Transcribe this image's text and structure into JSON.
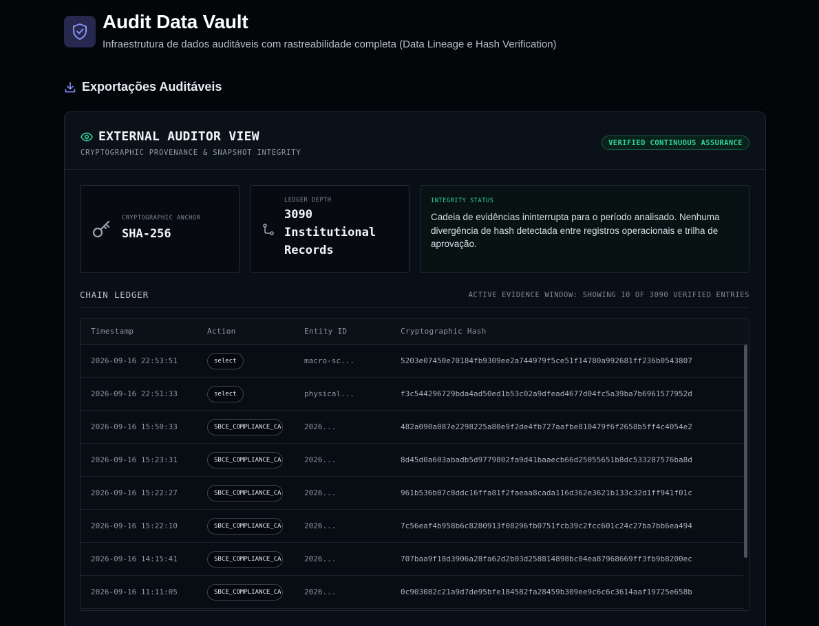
{
  "app": {
    "title": "Audit Data Vault",
    "subtitle": "Infraestrutura de dados auditáveis com rastreabilidade completa (Data Lineage e Hash Verification)"
  },
  "section": {
    "title": "Exportações Auditáveis"
  },
  "auditor_view": {
    "title": "EXTERNAL AUDITOR VIEW",
    "subtitle": "CRYPTOGRAPHIC PROVENANCE & SNAPSHOT INTEGRITY",
    "badge": "VERIFIED CONTINUOUS ASSURANCE"
  },
  "stats": {
    "anchor": {
      "label": "CRYPTOGRAPHIC ANCHOR",
      "value": "SHA-256"
    },
    "depth": {
      "label": "LEDGER DEPTH",
      "value": "3090 Institutional Records"
    },
    "integrity": {
      "label": "INTEGRITY STATUS",
      "text": "Cadeia de evidências ininterrupta para o período analisado. Nenhuma divergência de hash detectada entre registros operacionais e trilha de aprovação."
    }
  },
  "ledger": {
    "title": "CHAIN LEDGER",
    "meta": "ACTIVE EVIDENCE WINDOW: SHOWING 10 OF 3090 VERIFIED ENTRIES",
    "columns": [
      "Timestamp",
      "Action",
      "Entity ID",
      "Cryptographic Hash"
    ],
    "rows": [
      {
        "timestamp": "2026-09-16 22:53:51",
        "action": "select",
        "entity": "macro-sc...",
        "hash": "5203e07450e70184fb9309ee2a744979f5ce51f14780a992681ff236b0543807"
      },
      {
        "timestamp": "2026-09-16 22:51:33",
        "action": "select",
        "entity": "physical...",
        "hash": "f3c544296729bda4ad50ed1b53c02a9dfead4677d04fc5a39ba7b6961577952d"
      },
      {
        "timestamp": "2026-09-16 15:50:33",
        "action": "SBCE_COMPLIANCE_CA",
        "entity": "2026...",
        "hash": "482a090a087e2298225a80e9f2de4fb727aafbe810479f6f2658b5ff4c4054e2"
      },
      {
        "timestamp": "2026-09-16 15:23:31",
        "action": "SBCE_COMPLIANCE_CA",
        "entity": "2026...",
        "hash": "8d45d0a603abadb5d9779802fa9d41baaecb66d25055651b8dc533287576ba8d"
      },
      {
        "timestamp": "2026-09-16 15:22:27",
        "action": "SBCE_COMPLIANCE_CA",
        "entity": "2026...",
        "hash": "961b536b07c8ddc16ffa81f2faeaa8cada116d362e3621b133c32d1ff941f01c"
      },
      {
        "timestamp": "2026-09-16 15:22:10",
        "action": "SBCE_COMPLIANCE_CA",
        "entity": "2026...",
        "hash": "7c56eaf4b958b6c8280913f08296fb0751fcb39c2fcc601c24c27ba7bb6ea494"
      },
      {
        "timestamp": "2026-09-16 14:15:41",
        "action": "SBCE_COMPLIANCE_CA",
        "entity": "2026...",
        "hash": "707baa9f18d3906a28fa62d2b03d258814898bc04ea87968669ff3fb9b8200ec"
      },
      {
        "timestamp": "2026-09-16 11:11:05",
        "action": "SBCE_COMPLIANCE_CA",
        "entity": "2026...",
        "hash": "0c903082c21a9d7de95bfe184582fa28459b309ee9c6c6c3614aaf19725e658b"
      }
    ]
  },
  "colors": {
    "background": "#030609",
    "accent_indigo": "#818cf8",
    "accent_green": "#34d399"
  },
  "icons": {
    "logo": "shield-check-icon",
    "section": "download-icon",
    "view": "eye-icon",
    "anchor": "key-icon",
    "depth": "git-branch-icon"
  }
}
